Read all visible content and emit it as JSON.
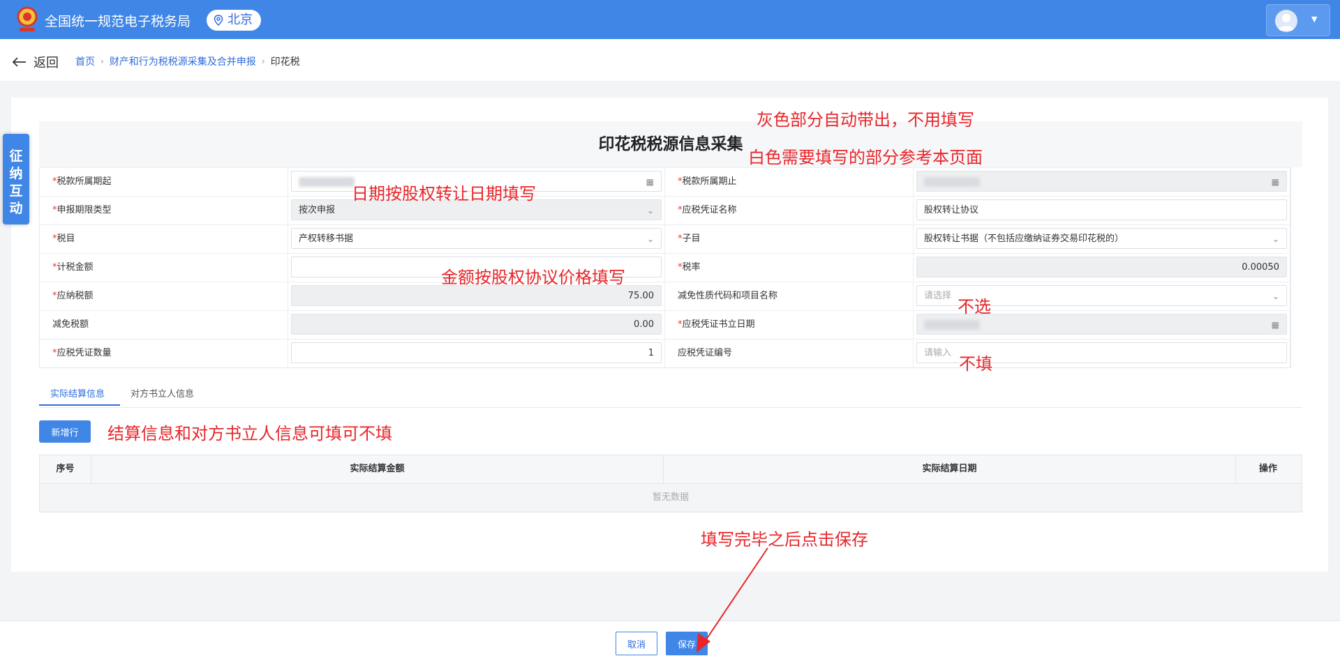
{
  "header": {
    "app_title": "全国统一规范电子税务局",
    "region": "北京"
  },
  "nav": {
    "back_label": "返回",
    "breadcrumb": [
      "首页",
      "财产和行为税税源采集及合并申报",
      "印花税"
    ]
  },
  "side_tab": {
    "label": "征纳互动"
  },
  "form": {
    "title": "印花税税源信息采集",
    "rows": [
      {
        "left": {
          "label": "税款所属期起",
          "required": true,
          "value": "",
          "kind": "date"
        },
        "right": {
          "label": "税款所属期止",
          "required": true,
          "value": "",
          "kind": "date-gray"
        }
      },
      {
        "left": {
          "label": "申报期限类型",
          "required": true,
          "value": "按次申报",
          "kind": "select-gray"
        },
        "right": {
          "label": "应税凭证名称",
          "required": true,
          "value": "股权转让协议",
          "kind": "input"
        }
      },
      {
        "left": {
          "label": "税目",
          "required": true,
          "value": "产权转移书据",
          "kind": "select"
        },
        "right": {
          "label": "子目",
          "required": true,
          "value": "股权转让书据（不包括应缴纳证券交易印花税的）",
          "kind": "select"
        }
      },
      {
        "left": {
          "label": "计税金额",
          "required": true,
          "value": "",
          "kind": "input"
        },
        "right": {
          "label": "税率",
          "required": true,
          "value": "0.00050",
          "kind": "gray-right"
        }
      },
      {
        "left": {
          "label": "应纳税额",
          "required": true,
          "value": "75.00",
          "kind": "gray-right"
        },
        "right": {
          "label": "减免性质代码和项目名称",
          "required": false,
          "value": "",
          "placeholder": "请选择",
          "kind": "select"
        }
      },
      {
        "left": {
          "label": "减免税额",
          "required": false,
          "value": "0.00",
          "kind": "gray-right"
        },
        "right": {
          "label": "应税凭证书立日期",
          "required": true,
          "value": "",
          "kind": "date-gray"
        }
      },
      {
        "left": {
          "label": "应税凭证数量",
          "required": true,
          "value": "1",
          "kind": "input-right"
        },
        "right": {
          "label": "应税凭证编号",
          "required": false,
          "value": "",
          "placeholder": "请输入",
          "kind": "input"
        }
      }
    ]
  },
  "tabs": {
    "items": [
      "实际结算信息",
      "对方书立人信息"
    ],
    "active_index": 0
  },
  "table": {
    "add_row_label": "新增行",
    "columns": [
      "序号",
      "实际结算金额",
      "实际结算日期",
      "操作"
    ],
    "empty_text": "暂无数据"
  },
  "footer": {
    "cancel_label": "取消",
    "save_label": "保存"
  },
  "annotations": {
    "gray_note": "灰色部分自动带出，不用填写",
    "white_note": "白色需要填写的部分参考本页面",
    "date_note": "日期按股权转让日期填写",
    "amount_note": "金额按股权协议价格填写",
    "no_select_note": "不选",
    "no_fill_note": "不填",
    "optional_note": "结算信息和对方书立人信息可填可不填",
    "save_note": "填写完毕之后点击保存"
  },
  "colors": {
    "primary": "#3f86e6",
    "annotation": "#e8262a",
    "required_mark": "#e53935"
  }
}
